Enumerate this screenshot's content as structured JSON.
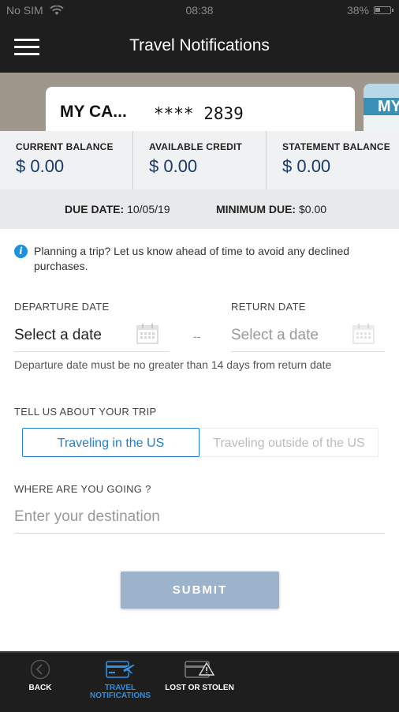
{
  "status_bar": {
    "carrier": "No SIM",
    "time": "08:38",
    "battery": "38%",
    "battery_level": 0.38
  },
  "header": {
    "title": "Travel Notifications"
  },
  "card": {
    "name": "MY CA...",
    "number": "**** 2839",
    "next_card_label": "MY"
  },
  "balances": [
    {
      "label": "CURRENT BALANCE",
      "value": "$ 0.00"
    },
    {
      "label": "AVAILABLE CREDIT",
      "value": "$ 0.00"
    },
    {
      "label": "STATEMENT BALANCE",
      "value": "$ 0.00"
    }
  ],
  "due": {
    "due_label": "DUE DATE:",
    "due_value": "10/05/19",
    "min_label": "MINIMUM DUE:",
    "min_value": "$0.00"
  },
  "info": {
    "text": "Planning a trip? Let us know ahead of time to avoid any declined purchases."
  },
  "dates": {
    "departure_label": "DEPARTURE DATE",
    "departure_value": "Select a date",
    "return_label": "RETURN DATE",
    "return_value": "Select a date",
    "separator": "--",
    "hint": "Departure date must be no greater than 14 days from return date"
  },
  "trip": {
    "label": "TELL US ABOUT YOUR TRIP",
    "option_us": "Traveling in the US",
    "option_outside": "Traveling outside of the US",
    "selected": "option_us"
  },
  "destination": {
    "label": "WHERE ARE YOU GOING ?",
    "placeholder": "Enter your destination"
  },
  "submit": {
    "label": "SUBMIT"
  },
  "bottom_nav": {
    "back": "BACK",
    "travel": "TRAVEL\nNOTIFICATIONS",
    "lost": "LOST OR STOLEN"
  },
  "colors": {
    "accent": "#1e7fd6",
    "header_bg": "#1e1e1e",
    "submit_bg": "#9db3cc",
    "balance_value": "#1a3a6b",
    "active_nav": "#2f8fe0"
  },
  "icons": [
    "menu-icon",
    "wifi-icon",
    "battery-icon",
    "info-icon",
    "calendar-icon",
    "back-icon",
    "plane-card-icon",
    "warning-card-icon"
  ]
}
